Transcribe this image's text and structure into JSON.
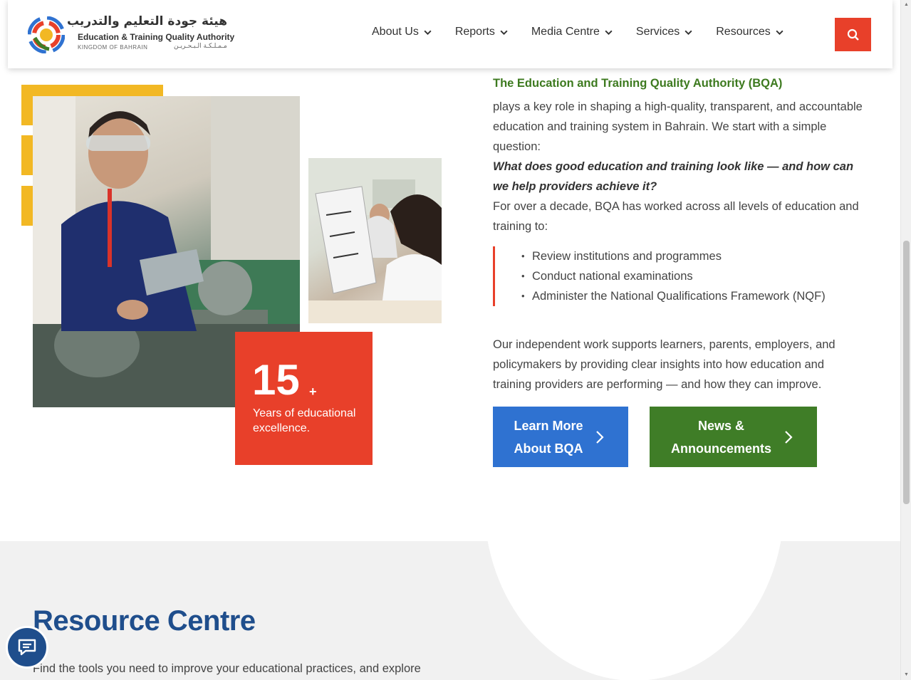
{
  "header": {
    "logo_ar": "هيئة جودة التعليم والتدريب",
    "logo_en": "Education & Training Quality Authority",
    "logo_sub": "KINGDOM OF BAHRAIN",
    "logo_sub_ar": "مـمـلـكـة الـبـحـريـن",
    "nav": [
      {
        "label": "About Us"
      },
      {
        "label": "Reports"
      },
      {
        "label": "Media Centre"
      },
      {
        "label": "Services"
      },
      {
        "label": "Resources"
      }
    ],
    "search_icon": "search-icon"
  },
  "stat": {
    "number": "15",
    "plus": "+",
    "label": "Years of educational excellence."
  },
  "about": {
    "title": "The Education and Training Quality Authority (BQA)",
    "intro": "plays a key role in shaping a high-quality, transparent, and accountable education and training system in Bahrain. We start with a simple question:",
    "question": "What does good education and training look like — and how can we help providers achieve it?",
    "decade": "For over a decade, BQA has worked across all levels of education and training to:",
    "bullets": [
      "Review institutions and programmes",
      "Conduct national examinations",
      "Administer the National Qualifications Framework (NQF)"
    ],
    "closing": "Our independent work supports learners, parents, employers, and policymakers by providing clear insights into how education and training providers are performing — and how they can improve."
  },
  "buttons": {
    "learn_more": "Learn More About BQA",
    "news": "News & Announcements"
  },
  "resource": {
    "title": "Resource Centre",
    "text": "Find the tools you need to improve your educational practices, and explore"
  },
  "colors": {
    "accent_red": "#e8402a",
    "yellow": "#f2b824",
    "green": "#3f7d27",
    "blue": "#2f72d1",
    "navy": "#1f4e8c"
  }
}
